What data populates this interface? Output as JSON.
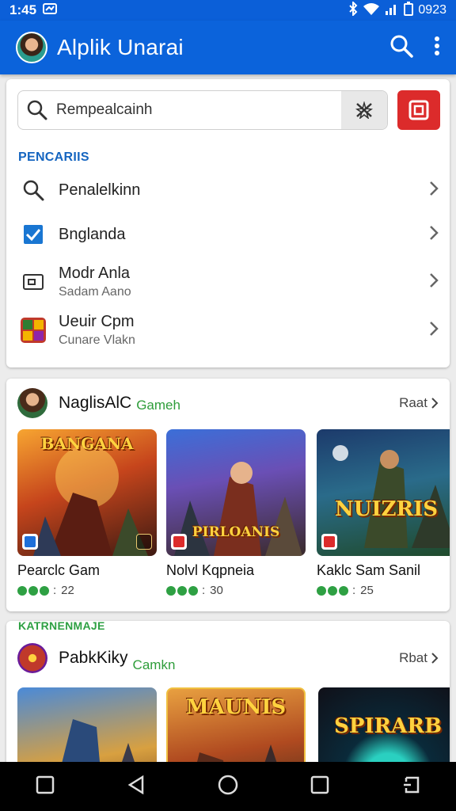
{
  "status": {
    "time": "1:45",
    "battery": "0923"
  },
  "appbar": {
    "title": "Alplik Unarai"
  },
  "search": {
    "value": "Rempealcainh"
  },
  "section": {
    "title": "PENCARIIS"
  },
  "list": [
    {
      "main": "Penalelkinn",
      "sub": "",
      "icon": "search-icon"
    },
    {
      "main": "Bnglanda",
      "sub": "",
      "icon": "checkbox-icon"
    },
    {
      "main": "Modr Anla",
      "sub": "Sadam Aano",
      "icon": "image-icon"
    },
    {
      "main": "Ueuir Cpm",
      "sub": "Cunare Vlakn",
      "icon": "game-thumbnail-icon"
    }
  ],
  "games1": {
    "title": "NaglisAlC",
    "tag": "Gameh",
    "more": "Raat",
    "tiles": [
      {
        "name": "Pearclc Gam",
        "rating": "22",
        "logo": "BANGANA"
      },
      {
        "name": "Nolvl Kqpneia",
        "rating": "30",
        "logo": "PIRLOANIS"
      },
      {
        "name": "Kaklc Sam Sanil",
        "rating": "25",
        "logo": "NUIZRIS"
      }
    ]
  },
  "games2": {
    "category": "KATRNENMAJE",
    "title": "PabkKiky",
    "tag": "Camkn",
    "more": "Rbat",
    "tiles": [
      {
        "logo": ""
      },
      {
        "logo": "MAUNIS"
      },
      {
        "logo": "SPIRARB"
      }
    ]
  },
  "colors": {
    "primary": "#0b63db",
    "accent_red": "#dc2b2b",
    "green": "#2ea043",
    "link_blue": "#1565c0"
  }
}
